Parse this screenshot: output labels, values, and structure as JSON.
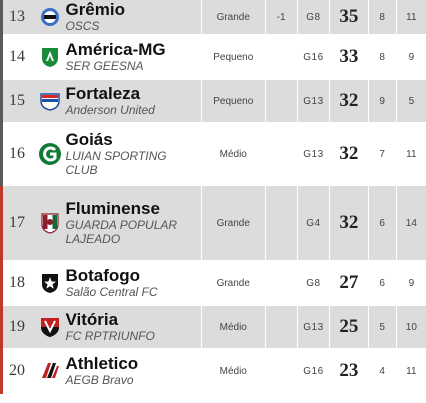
{
  "rows": [
    {
      "pos": "13",
      "team": "Grêmio",
      "coach": "OSCS",
      "size": "Grande",
      "delta": "-1",
      "group": "G8",
      "points": "35",
      "w": "8",
      "l": "11",
      "crest": "gremio-crest-icon",
      "crest_color": "#3a6fc4"
    },
    {
      "pos": "14",
      "team": "América-MG",
      "coach": "SER GEESNA",
      "size": "Pequeno",
      "delta": "",
      "group": "G16",
      "points": "33",
      "w": "8",
      "l": "9",
      "crest": "america-mg-crest-icon",
      "crest_color": "#1a8a3a"
    },
    {
      "pos": "15",
      "team": "Fortaleza",
      "coach": "Anderson United",
      "size": "Pequeno",
      "delta": "",
      "group": "G13",
      "points": "32",
      "w": "9",
      "l": "5",
      "crest": "fortaleza-crest-icon",
      "crest_color": "#1f4fa8"
    },
    {
      "pos": "16",
      "team": "Goiás",
      "coach": "LUIAN SPORTING CLUB",
      "size": "Médio",
      "delta": "",
      "group": "G13",
      "points": "32",
      "w": "7",
      "l": "11",
      "crest": "goias-crest-icon",
      "crest_color": "#0f7a36"
    },
    {
      "pos": "17",
      "team": "Fluminense",
      "coach": "GUARDA POPULAR LAJEADO",
      "size": "Grande",
      "delta": "",
      "group": "G4",
      "points": "32",
      "w": "6",
      "l": "14",
      "crest": "fluminense-crest-icon",
      "crest_color": "#8b1e2c"
    },
    {
      "pos": "18",
      "team": "Botafogo",
      "coach": "Salão Central FC",
      "size": "Grande",
      "delta": "",
      "group": "G8",
      "points": "27",
      "w": "6",
      "l": "9",
      "crest": "botafogo-crest-icon",
      "crest_color": "#111111"
    },
    {
      "pos": "19",
      "team": "Vitória",
      "coach": "FC RPTRIUNFO",
      "size": "Médio",
      "delta": "",
      "group": "G13",
      "points": "25",
      "w": "5",
      "l": "10",
      "crest": "vitoria-crest-icon",
      "crest_color": "#c0201f"
    },
    {
      "pos": "20",
      "team": "Athletico",
      "coach": "AEGB Bravo",
      "size": "Médio",
      "delta": "",
      "group": "G16",
      "points": "23",
      "w": "4",
      "l": "11",
      "crest": "athletico-crest-icon",
      "crest_color": "#c0201f"
    }
  ]
}
